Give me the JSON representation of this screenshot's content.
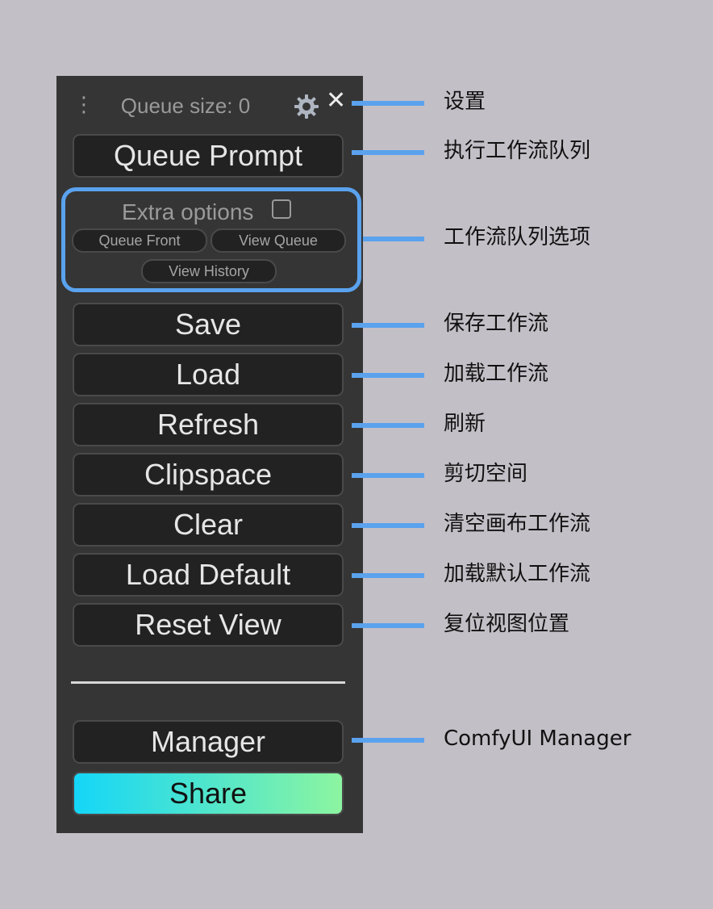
{
  "panel": {
    "drag_handle": "⋮",
    "queue_size": "Queue size: 0",
    "close": "✕",
    "queue_prompt": "Queue Prompt",
    "extra_options": {
      "label": "Extra options",
      "checked": false,
      "queue_front": "Queue Front",
      "view_queue": "View Queue",
      "view_history": "View History"
    },
    "buttons": {
      "save": "Save",
      "load": "Load",
      "refresh": "Refresh",
      "clipspace": "Clipspace",
      "clear": "Clear",
      "load_default": "Load Default",
      "reset_view": "Reset View",
      "manager": "Manager",
      "share": "Share"
    }
  },
  "annotations": {
    "settings": "设置",
    "queue_prompt": "执行工作流队列",
    "extra_options": "工作流队列选项",
    "save": "保存工作流",
    "load": "加载工作流",
    "refresh": "刷新",
    "clipspace": "剪切空间",
    "clear": "清空画布工作流",
    "load_default": "加载默认工作流",
    "reset_view": "复位视图位置",
    "manager": "ComfyUI Manager"
  },
  "colors": {
    "background": "#c3bfc6",
    "panel": "#353535",
    "button": "#222222",
    "accent_blue": "#5aa2ee",
    "share_gradient_start": "#14d6f8",
    "share_gradient_end": "#8cf5a0"
  },
  "icons": {
    "settings": "gear-icon",
    "close": "close-icon",
    "drag": "drag-handle-icon"
  }
}
